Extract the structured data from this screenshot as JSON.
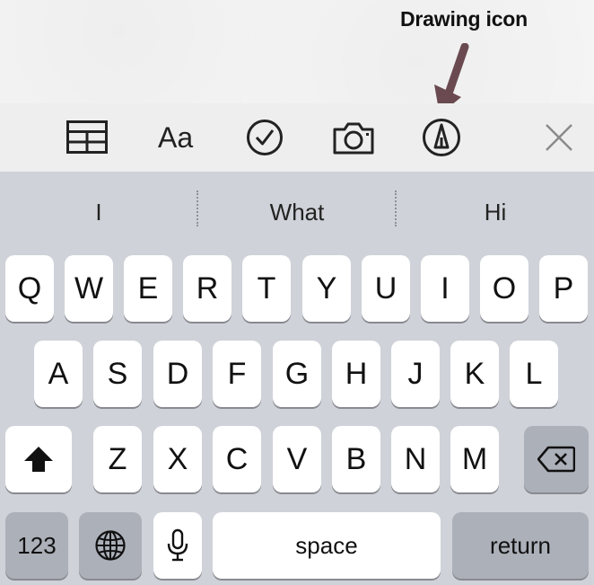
{
  "annotation": {
    "label": "Drawing icon"
  },
  "toolbar": {
    "items": [
      {
        "name": "table-icon"
      },
      {
        "name": "format-text",
        "label": "Aa"
      },
      {
        "name": "checklist-icon"
      },
      {
        "name": "camera-icon"
      },
      {
        "name": "drawing-icon"
      },
      {
        "name": "close-icon"
      }
    ]
  },
  "suggestions": [
    "I",
    "What",
    "Hi"
  ],
  "keyboard": {
    "row1": [
      "Q",
      "W",
      "E",
      "R",
      "T",
      "Y",
      "U",
      "I",
      "O",
      "P"
    ],
    "row2": [
      "A",
      "S",
      "D",
      "F",
      "G",
      "H",
      "J",
      "K",
      "L"
    ],
    "row3": [
      "Z",
      "X",
      "C",
      "V",
      "B",
      "N",
      "M"
    ],
    "numbers_label": "123",
    "space_label": "space",
    "return_label": "return",
    "shift_icon": "shift-icon",
    "delete_icon": "delete-icon",
    "globe_icon": "globe-icon",
    "mic_icon": "microphone-icon"
  },
  "colors": {
    "keyboard_bg": "#cfd2d8",
    "key_light": "#ffffff",
    "key_dark": "#acb0b9",
    "toolbar_bg": "#eeeeef",
    "arrow": "#6a4a50"
  }
}
